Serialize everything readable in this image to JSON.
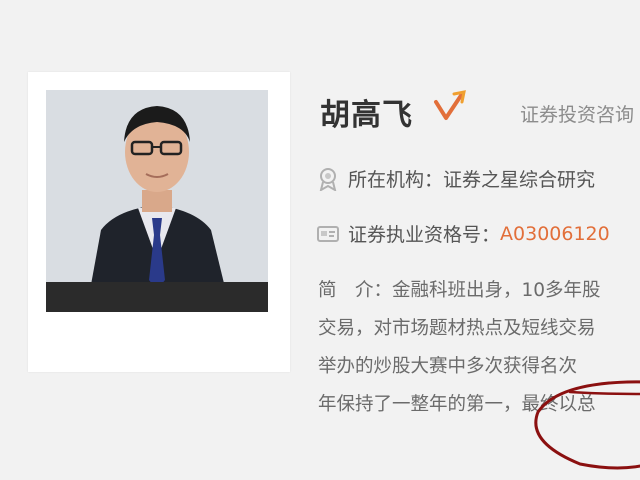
{
  "profile": {
    "name": "胡高飞",
    "title_tag": "证券投资咨询",
    "org_label": "所在机构：",
    "org_value": "证券之星综合研究",
    "license_label": "证券执业资格号：",
    "license_value": "A03006120",
    "bio_lines": [
      "简　介：金融科班出身，10多年股",
      "交易，对市场题材热点及短线交易",
      "举办的炒股大赛中多次获得名次",
      "年保持了一整年的第一，最终以总"
    ]
  },
  "icons": {
    "verified": "orange-check-v-icon",
    "org": "award-medal-icon",
    "license": "id-card-icon"
  },
  "colors": {
    "accent_orange": "#e26f3a",
    "annotation_red": "#8b1010"
  }
}
